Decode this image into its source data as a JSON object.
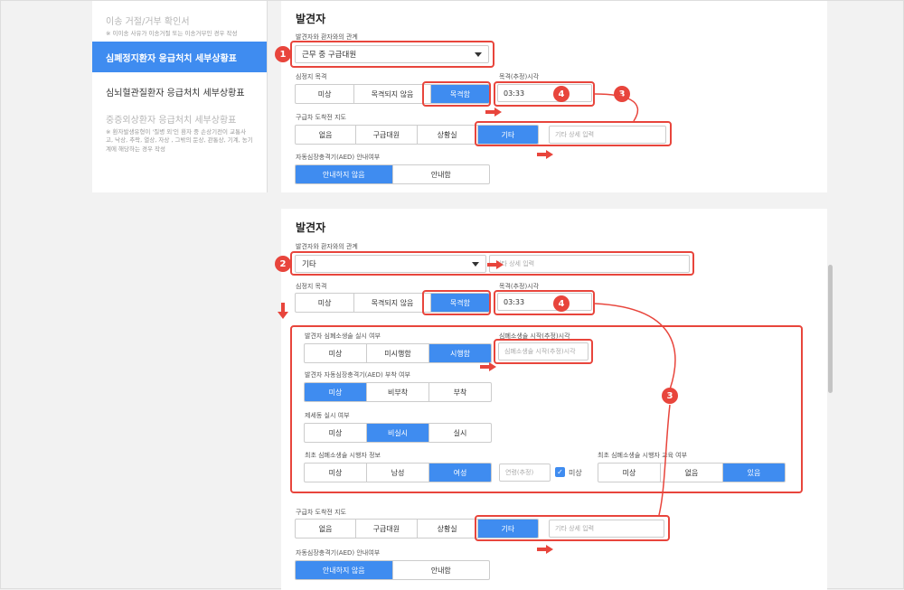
{
  "sidebar": {
    "items": [
      {
        "label": "이송 거절/거부 확인서",
        "sub": "※ 이이송 사유가 이송거절 또는 이송거부인 경우 작성",
        "state": "disabled"
      },
      {
        "label": "심폐정지환자 응급처치 세부상황표",
        "sub": "",
        "state": "active"
      },
      {
        "label": "심뇌혈관질환자 응급처치 세부상황표",
        "sub": "",
        "state": "normal"
      },
      {
        "label": "중증외상환자 응급처치 세부상황표",
        "sub": "※ 환자발생유형이 '질병 외'인 환자 중 손상기전이 교통사고, 낙상, 추락, 열상, 자상 , 그밖의 둔상, 관통상, 기계, 농기계에 해당하는 경우 작성",
        "state": "disabled"
      }
    ]
  },
  "top": {
    "title": "발견자",
    "relation_label": "발견자와 환자와의 관계",
    "relation_value": "근무 중 구급대원",
    "witness_label": "심정지 목격",
    "witness_options": [
      "미상",
      "목격되지 않음",
      "목격함"
    ],
    "witness_selected": 2,
    "witness_time_label": "목격(추정)시각",
    "witness_time_value": "03:33",
    "cpr_guide_label": "구급차 도착전 지도",
    "cpr_guide_options": [
      "없음",
      "구급대원",
      "상황실",
      "기타"
    ],
    "cpr_guide_selected": 3,
    "cpr_guide_placeholder": "기타 상세 입력",
    "aed_guide_label": "자동심장충격기(AED) 안내여부",
    "aed_guide_options": [
      "안내하지 않음",
      "안내함"
    ],
    "aed_guide_selected": 0
  },
  "bottom": {
    "title": "발견자",
    "relation_label": "발견자와 환자와의 관계",
    "relation_value": "기타",
    "relation_placeholder": "기타 상세 입력",
    "witness_label": "심정지 목격",
    "witness_options": [
      "미상",
      "목격되지 않음",
      "목격함"
    ],
    "witness_selected": 2,
    "witness_time_label": "목격(추정)시각",
    "witness_time_value": "03:33",
    "cpr_label": "발견자 심폐소생술 실시 여부",
    "cpr_options": [
      "미상",
      "미시행함",
      "시행함"
    ],
    "cpr_selected": 2,
    "cpr_start_label": "심폐소생술 시작(추정)시각",
    "cpr_start_placeholder": "심폐소생술 시작(추정)시각",
    "aed_attach_label": "발견자 자동심장충격기(AED) 부착 여부",
    "aed_attach_options": [
      "미상",
      "비부착",
      "부착"
    ],
    "aed_attach_selected": 0,
    "defib_label": "제세동 실시 여부",
    "defib_options": [
      "미상",
      "비실시",
      "실시"
    ],
    "defib_selected": 1,
    "first_cpr_label": "최초 심폐소생술 시행자 정보",
    "first_cpr_options": [
      "미상",
      "남성",
      "여성"
    ],
    "first_cpr_selected": 2,
    "age_placeholder": "연령(추정)",
    "age_unknown_label": "미상",
    "training_label": "최초 심폐소생술 시행자 교육 여부",
    "training_options": [
      "미상",
      "없음",
      "있음"
    ],
    "training_selected": 2,
    "cpr_guide_label": "구급차 도착전 지도",
    "cpr_guide_options": [
      "없음",
      "구급대원",
      "상황실",
      "기타"
    ],
    "cpr_guide_selected": 3,
    "cpr_guide_placeholder": "기타 상세 입력",
    "aed_guide_label": "자동심장충격기(AED) 안내여부",
    "aed_guide_options": [
      "안내하지 않음",
      "안내함"
    ],
    "aed_guide_selected": 0
  },
  "badges": {
    "b1": "1",
    "b2": "2",
    "b3": "3",
    "b4": "4"
  },
  "colors": {
    "accent": "#3f8cf0",
    "annotation": "#e8453c"
  }
}
